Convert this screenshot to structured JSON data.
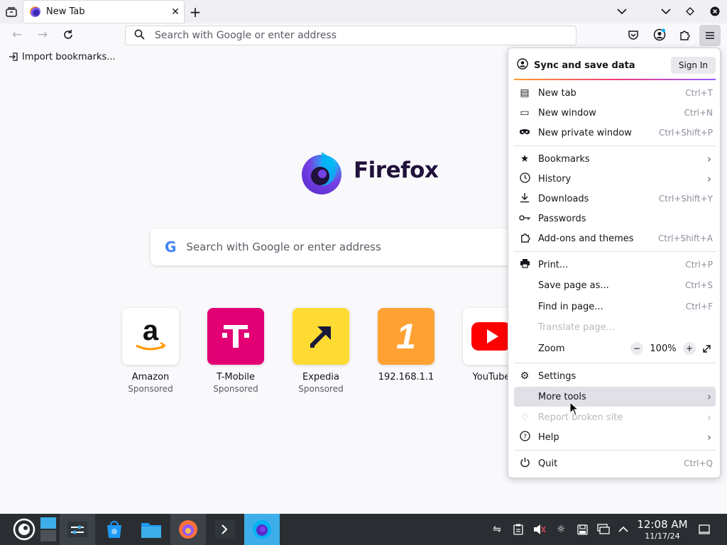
{
  "tabbar": {
    "tab_title": "New Tab"
  },
  "navbar": {
    "url_placeholder": "Search with Google or enter address"
  },
  "bookmarks_bar": {
    "import_label": "Import bookmarks..."
  },
  "newtab": {
    "brand": "Firefox",
    "search_placeholder": "Search with Google or enter address",
    "search_logo": "G",
    "top_sites": [
      {
        "name": "Amazon",
        "sponsor": "Sponsored",
        "tile_letter": "a",
        "bg": "#ffffff"
      },
      {
        "name": "T-Mobile",
        "sponsor": "Sponsored",
        "tile_letter": "T",
        "bg": "#e20074"
      },
      {
        "name": "Expedia",
        "sponsor": "Sponsored",
        "tile_letter": "↗",
        "bg": "#fdd835"
      },
      {
        "name": "192.168.1.1",
        "sponsor": "",
        "tile_letter": "1",
        "bg": "#ffa133"
      },
      {
        "name": "YouTube",
        "sponsor": "",
        "tile_letter": "▶",
        "bg": "#ffffff"
      }
    ]
  },
  "app_menu": {
    "sync_label": "Sync and save data",
    "sign_in": "Sign In",
    "items": {
      "new_tab": {
        "label": "New tab",
        "shortcut": "Ctrl+T"
      },
      "new_window": {
        "label": "New window",
        "shortcut": "Ctrl+N"
      },
      "new_private": {
        "label": "New private window",
        "shortcut": "Ctrl+Shift+P"
      },
      "bookmarks": {
        "label": "Bookmarks"
      },
      "history": {
        "label": "History"
      },
      "downloads": {
        "label": "Downloads",
        "shortcut": "Ctrl+Shift+Y"
      },
      "passwords": {
        "label": "Passwords"
      },
      "addons": {
        "label": "Add-ons and themes",
        "shortcut": "Ctrl+Shift+A"
      },
      "print": {
        "label": "Print...",
        "shortcut": "Ctrl+P"
      },
      "save_page": {
        "label": "Save page as...",
        "shortcut": "Ctrl+S"
      },
      "find": {
        "label": "Find in page...",
        "shortcut": "Ctrl+F"
      },
      "translate": {
        "label": "Translate page..."
      },
      "zoom": {
        "label": "Zoom",
        "value": "100%",
        "minus": "−",
        "plus": "+"
      },
      "settings": {
        "label": "Settings"
      },
      "more_tools": {
        "label": "More tools"
      },
      "report": {
        "label": "Report broken site"
      },
      "help": {
        "label": "Help"
      },
      "quit": {
        "label": "Quit",
        "shortcut": "Ctrl+Q"
      }
    }
  },
  "taskbar": {
    "time": "12:08 AM",
    "date": "11/17/24"
  }
}
